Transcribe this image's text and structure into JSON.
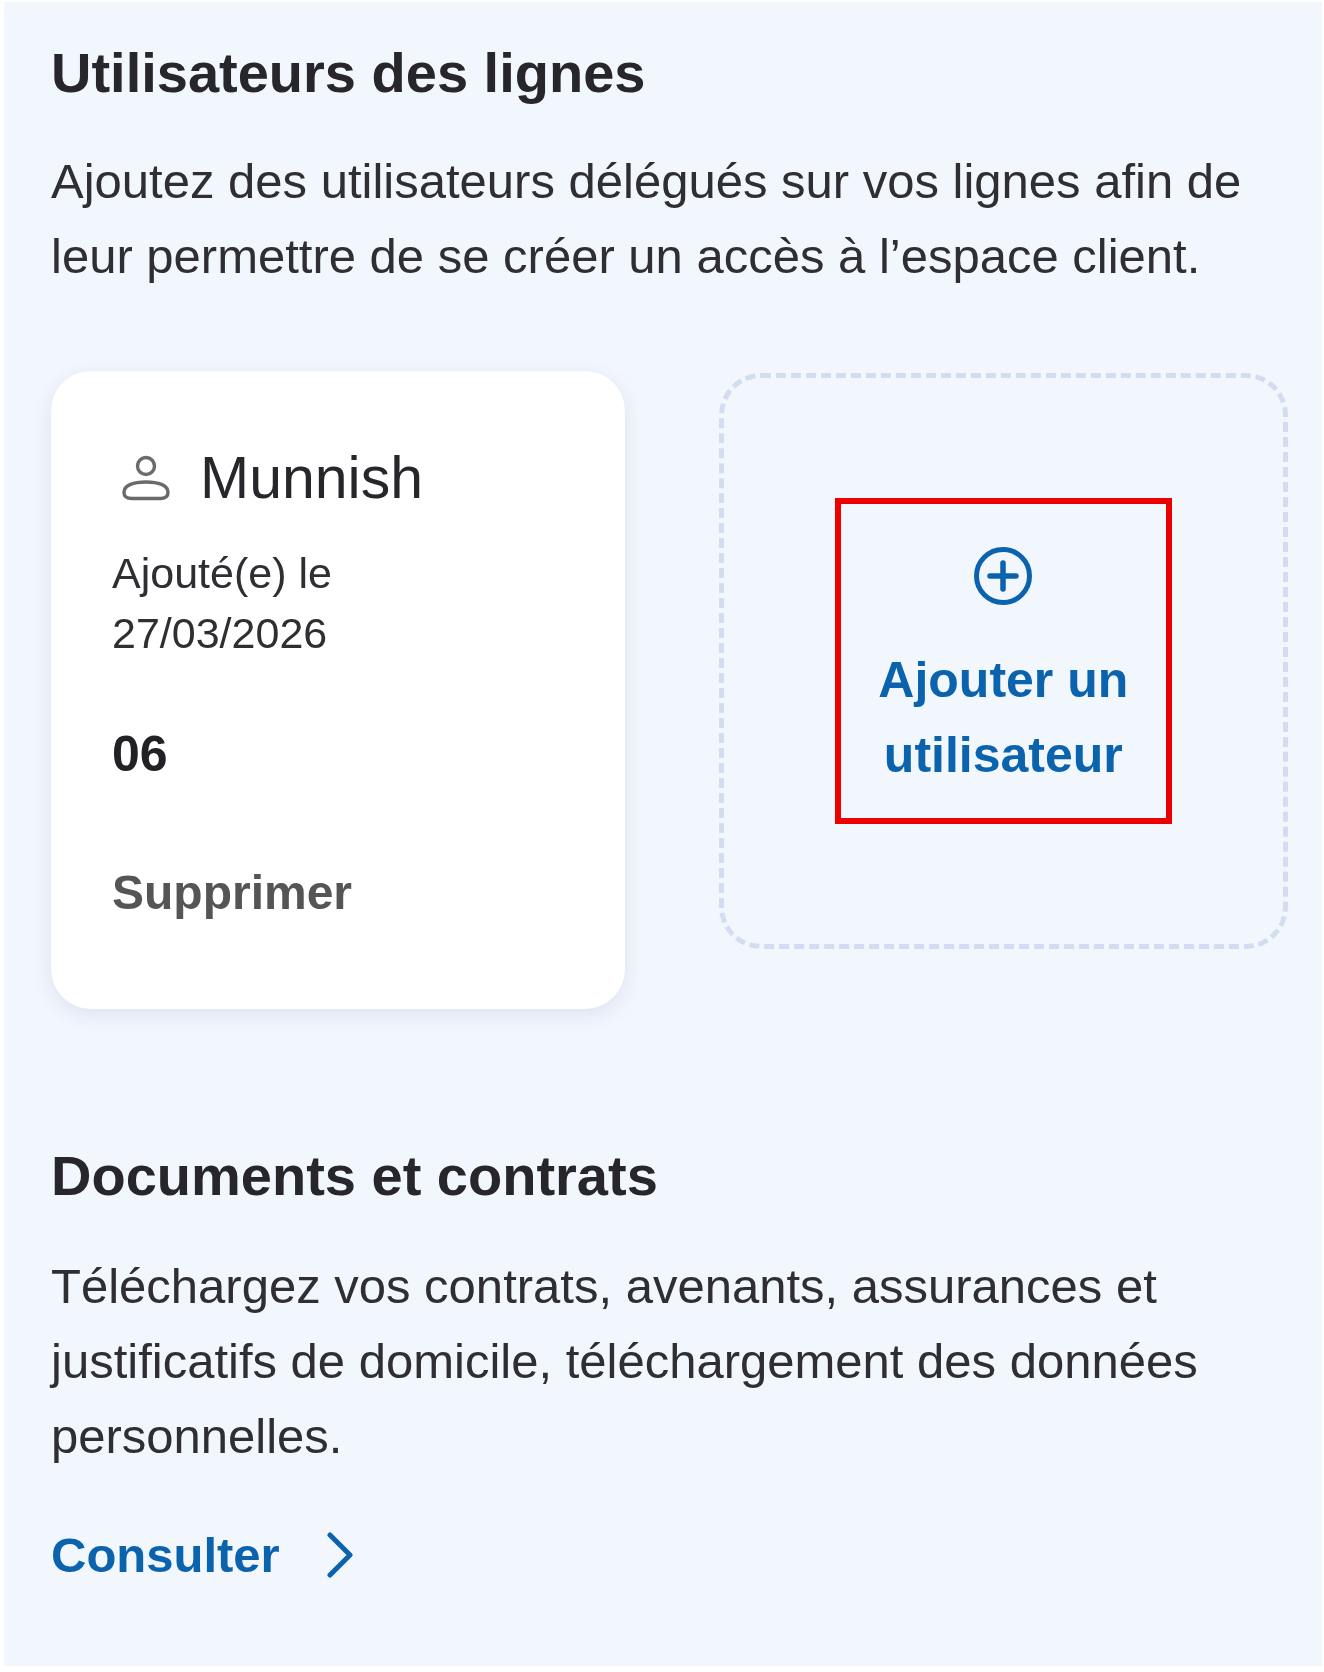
{
  "users_section": {
    "title": "Utilisateurs des lignes",
    "description": "Ajoutez des utilisateurs délégués sur vos lignes afin de leur permettre de se créer un accès à l’espace client.",
    "users": [
      {
        "name": "Munnish",
        "added_label": "Ajouté(e) le",
        "added_date": "27/03/2026",
        "line": "06",
        "delete_label": "Supprimer"
      }
    ],
    "add_user": {
      "label": "Ajouter un utilisateur",
      "highlighted": true
    }
  },
  "documents_section": {
    "title": "Documents et contrats",
    "description": "Téléchargez vos contrats, avenants, assurances et justificatifs de domicile, téléchargement des données personnelles.",
    "link": {
      "label": "Consulter"
    }
  }
}
